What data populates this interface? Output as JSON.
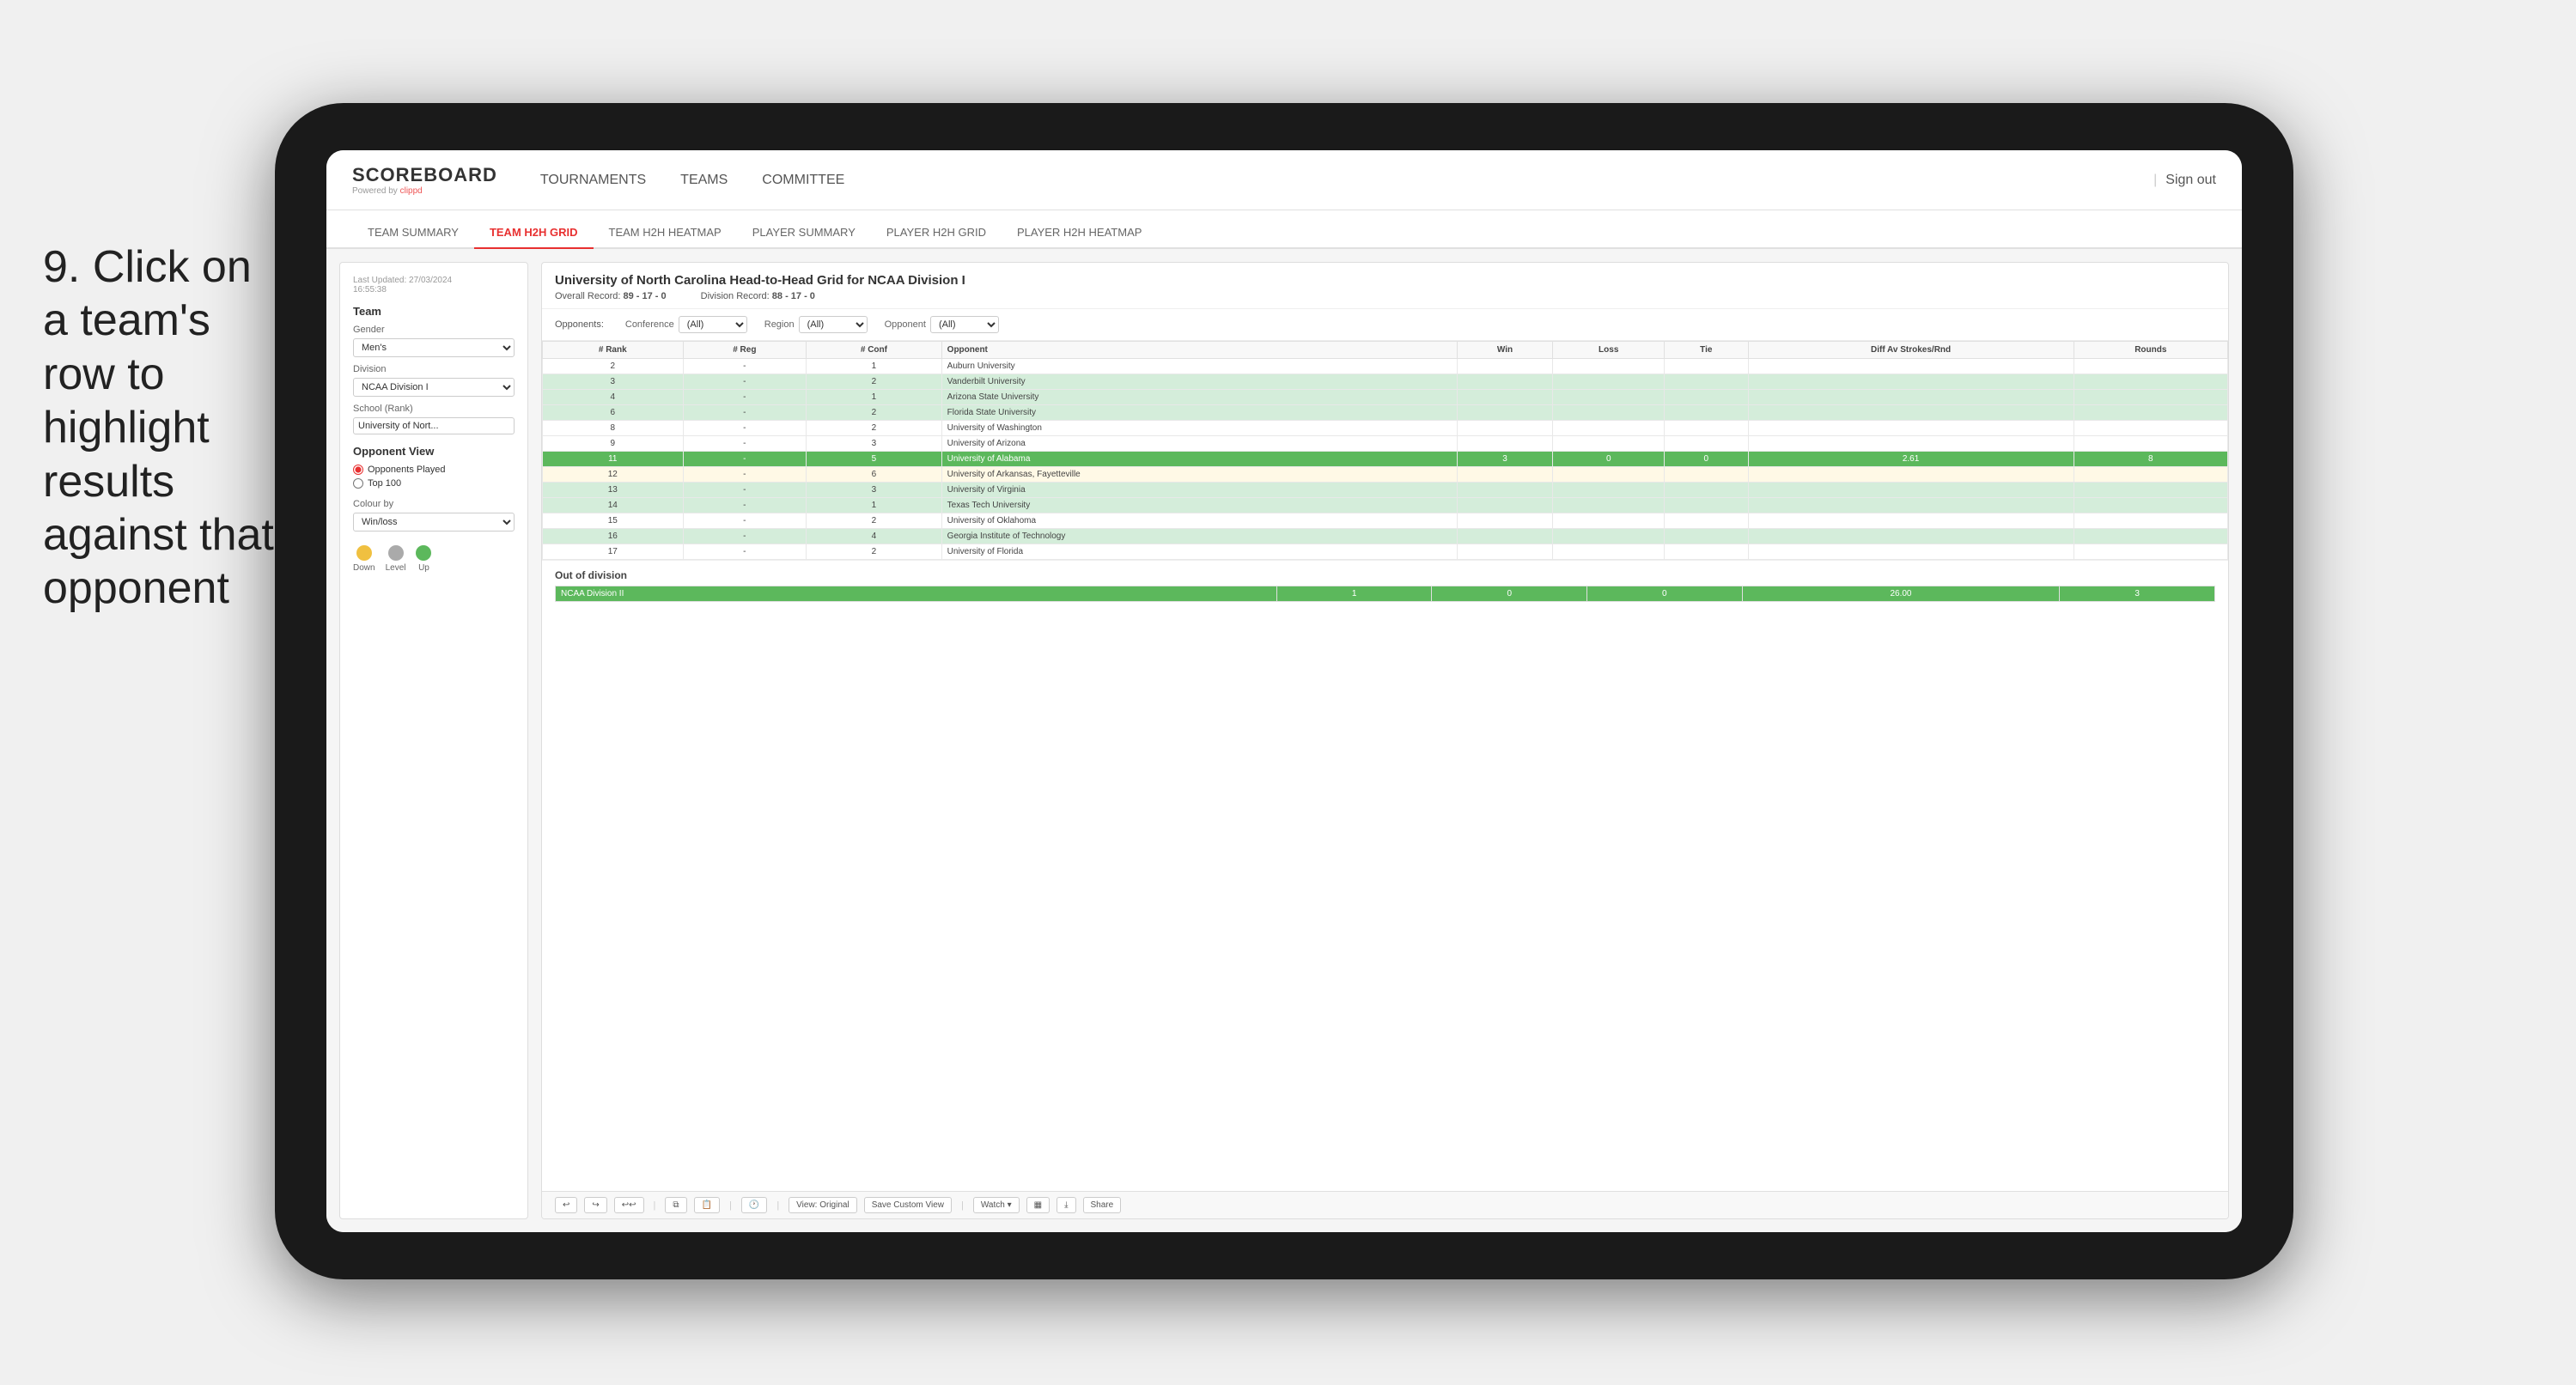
{
  "instruction": {
    "number": "9.",
    "text": "Click on a team's row to highlight results against that opponent"
  },
  "nav": {
    "logo": "SCOREBOARD",
    "logo_sub": "Powered by clippd",
    "links": [
      "TOURNAMENTS",
      "TEAMS",
      "COMMITTEE"
    ],
    "sign_in": "Sign out",
    "divider": "|"
  },
  "sub_nav": {
    "items": [
      "TEAM SUMMARY",
      "TEAM H2H GRID",
      "TEAM H2H HEATMAP",
      "PLAYER SUMMARY",
      "PLAYER H2H GRID",
      "PLAYER H2H HEATMAP"
    ],
    "active": "TEAM H2H GRID"
  },
  "sidebar": {
    "last_updated_label": "Last Updated: 27/03/2024",
    "last_updated_time": "16:55:38",
    "team_label": "Team",
    "gender_label": "Gender",
    "gender_value": "Men's",
    "division_label": "Division",
    "division_value": "NCAA Division I",
    "school_label": "School (Rank)",
    "school_value": "University of Nort...",
    "opponent_view_label": "Opponent View",
    "radio_opponents": "Opponents Played",
    "radio_top100": "Top 100",
    "colour_by_label": "Colour by",
    "colour_by_value": "Win/loss",
    "colour_down": "Down",
    "colour_level": "Level",
    "colour_up": "Up"
  },
  "grid": {
    "title": "University of North Carolina Head-to-Head Grid for NCAA Division I",
    "overall_record_label": "Overall Record:",
    "overall_record_value": "89 - 17 - 0",
    "division_record_label": "Division Record:",
    "division_record_value": "88 - 17 - 0",
    "filters": {
      "opponents_label": "Opponents:",
      "conference_label": "Conference",
      "conference_value": "(All)",
      "region_label": "Region",
      "region_value": "(All)",
      "opponent_label": "Opponent",
      "opponent_value": "(All)"
    },
    "columns": [
      "# Rank",
      "# Reg",
      "# Conf",
      "Opponent",
      "Win",
      "Loss",
      "Tie",
      "Diff Av Strokes/Rnd",
      "Rounds"
    ],
    "rows": [
      {
        "rank": "2",
        "reg": "-",
        "conf": "1",
        "opponent": "Auburn University",
        "win": "",
        "loss": "",
        "tie": "",
        "diff": "",
        "rounds": "",
        "style": "normal"
      },
      {
        "rank": "3",
        "reg": "-",
        "conf": "2",
        "opponent": "Vanderbilt University",
        "win": "",
        "loss": "",
        "tie": "",
        "diff": "",
        "rounds": "",
        "style": "light-green"
      },
      {
        "rank": "4",
        "reg": "-",
        "conf": "1",
        "opponent": "Arizona State University",
        "win": "",
        "loss": "",
        "tie": "",
        "diff": "",
        "rounds": "",
        "style": "light-green"
      },
      {
        "rank": "6",
        "reg": "-",
        "conf": "2",
        "opponent": "Florida State University",
        "win": "",
        "loss": "",
        "tie": "",
        "diff": "",
        "rounds": "",
        "style": "light-green"
      },
      {
        "rank": "8",
        "reg": "-",
        "conf": "2",
        "opponent": "University of Washington",
        "win": "",
        "loss": "",
        "tie": "",
        "diff": "",
        "rounds": "",
        "style": "normal"
      },
      {
        "rank": "9",
        "reg": "-",
        "conf": "3",
        "opponent": "University of Arizona",
        "win": "",
        "loss": "",
        "tie": "",
        "diff": "",
        "rounds": "",
        "style": "normal"
      },
      {
        "rank": "11",
        "reg": "-",
        "conf": "5",
        "opponent": "University of Alabama",
        "win": "3",
        "loss": "0",
        "tie": "0",
        "diff": "2.61",
        "rounds": "8",
        "style": "highlighted"
      },
      {
        "rank": "12",
        "reg": "-",
        "conf": "6",
        "opponent": "University of Arkansas, Fayetteville",
        "win": "",
        "loss": "",
        "tie": "",
        "diff": "",
        "rounds": "",
        "style": "light-yellow"
      },
      {
        "rank": "13",
        "reg": "-",
        "conf": "3",
        "opponent": "University of Virginia",
        "win": "",
        "loss": "",
        "tie": "",
        "diff": "",
        "rounds": "",
        "style": "light-green"
      },
      {
        "rank": "14",
        "reg": "-",
        "conf": "1",
        "opponent": "Texas Tech University",
        "win": "",
        "loss": "",
        "tie": "",
        "diff": "",
        "rounds": "",
        "style": "light-green"
      },
      {
        "rank": "15",
        "reg": "-",
        "conf": "2",
        "opponent": "University of Oklahoma",
        "win": "",
        "loss": "",
        "tie": "",
        "diff": "",
        "rounds": "",
        "style": "normal"
      },
      {
        "rank": "16",
        "reg": "-",
        "conf": "4",
        "opponent": "Georgia Institute of Technology",
        "win": "",
        "loss": "",
        "tie": "",
        "diff": "",
        "rounds": "",
        "style": "light-green"
      },
      {
        "rank": "17",
        "reg": "-",
        "conf": "2",
        "opponent": "University of Florida",
        "win": "",
        "loss": "",
        "tie": "",
        "diff": "",
        "rounds": "",
        "style": "normal"
      }
    ],
    "out_of_division_label": "Out of division",
    "out_of_division_row": {
      "name": "NCAA Division II",
      "win": "1",
      "loss": "0",
      "tie": "0",
      "diff": "26.00",
      "rounds": "3",
      "style": "highlighted"
    }
  },
  "toolbar": {
    "view_original": "View: Original",
    "save_custom": "Save Custom View",
    "watch": "Watch ▾",
    "share": "Share"
  }
}
